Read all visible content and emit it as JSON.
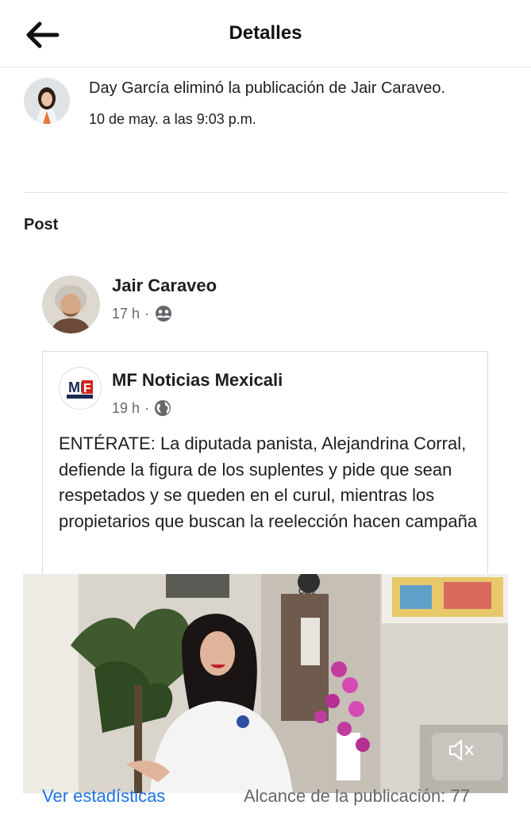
{
  "header": {
    "title": "Detalles"
  },
  "activity": {
    "text": "Day García eliminó la publicación de Jair Caraveo.",
    "time": "10 de may. a las 9:03 p.m."
  },
  "section_label": "Post",
  "post": {
    "author": "Jair Caraveo",
    "time": "17 h",
    "separator": "·",
    "audience_icon": "friends-icon"
  },
  "shared_post": {
    "page_name": "MF Noticias Mexicali",
    "logo_text": "MF",
    "time": "19 h",
    "separator": "·",
    "audience_icon": "globe-icon",
    "text": "ENTÉRATE: La diputada panista, Alejandrina Corral, defiende la figura de los suplentes y pide que sean respetados y se queden en el curul, mientras los propietarios que buscan la reelección hacen campaña",
    "video": {
      "muted_icon": "volume-muted-icon",
      "sign_text": "Café"
    }
  },
  "footer": {
    "stats_link": "Ver estadísticas",
    "reach": "Alcance de la publicación: 77"
  },
  "colors": {
    "link": "#1b74e4",
    "muted": "#65676b",
    "divider": "#e4e6eb"
  }
}
